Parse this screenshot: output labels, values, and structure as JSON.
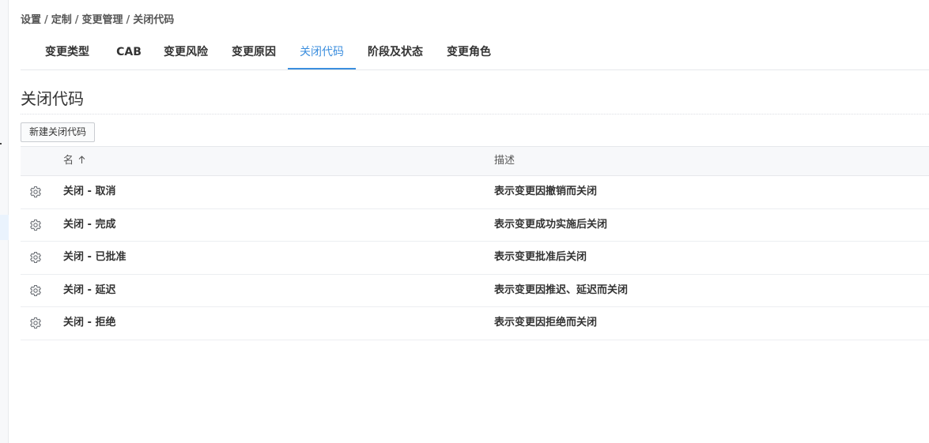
{
  "breadcrumb": {
    "items": [
      "设置",
      "定制",
      "变更管理",
      "关闭代码"
    ],
    "separator": "/"
  },
  "tabs": [
    {
      "label": "变更类型",
      "active": false
    },
    {
      "label": "CAB",
      "active": false
    },
    {
      "label": "变更风险",
      "active": false
    },
    {
      "label": "变更原因",
      "active": false
    },
    {
      "label": "关闭代码",
      "active": true
    },
    {
      "label": "阶段及状态",
      "active": false
    },
    {
      "label": "变更角色",
      "active": false
    }
  ],
  "page": {
    "title": "关闭代码",
    "new_button_label": "新建关闭代码"
  },
  "table": {
    "columns": [
      {
        "label": "名",
        "sort": "ascending",
        "sort_icon": "arrow-up-icon"
      },
      {
        "label": "描述"
      }
    ],
    "rows": [
      {
        "name": "关闭 - 取消",
        "description": "表示变更因撤销而关闭"
      },
      {
        "name": "关闭 - 完成",
        "description": "表示变更成功实施后关闭"
      },
      {
        "name": "关闭 - 已批准",
        "description": "表示变更批准后关闭"
      },
      {
        "name": "关闭 - 延迟",
        "description": "表示变更因推迟、延迟而关闭"
      },
      {
        "name": "关闭 - 拒绝",
        "description": "表示变更因拒绝而关闭"
      }
    ],
    "row_icon": "gear-icon"
  },
  "colors": {
    "accent": "#3b8ede",
    "header_bg": "#f7f8fa",
    "text": "#333333"
  }
}
